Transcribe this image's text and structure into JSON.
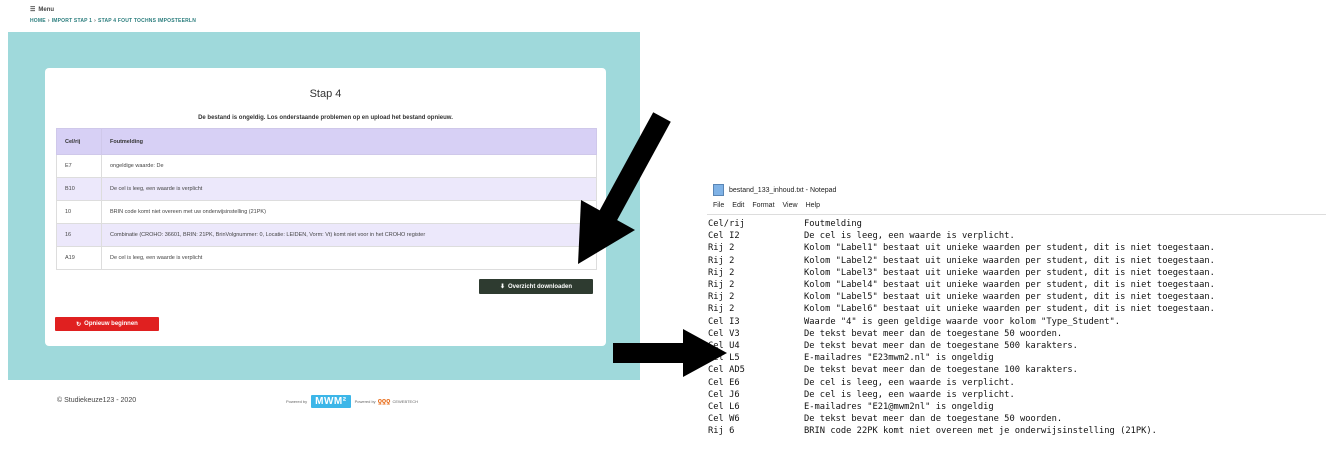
{
  "topnav": {
    "menu_label": "Menu",
    "crumbs": [
      "HOME",
      "IMPORT STAP 1",
      "STAP 4 FOUT TOCHNS IMPOSTEERLN"
    ]
  },
  "card": {
    "title": "Stap 4",
    "message": "De bestand is ongeldig. Los onderstaande problemen op en upload het bestand opnieuw.",
    "table": {
      "headers": [
        "Cel/rij",
        "Foutmelding"
      ],
      "rows": [
        [
          "E7",
          "ongeldige waarde: De"
        ],
        [
          "B10",
          "De cel is leeg, een waarde is verplicht"
        ],
        [
          "10",
          "BRIN code komt niet overeen met uw onderwijsinstelling (21PK)"
        ],
        [
          "16",
          "Combinatie (CROHO: 36601, BRIN: 21PK, BrinVolgnummer: 0, Locatie: LEIDEN, Vorm: Vt) komt niet voor in het CROHO register"
        ],
        [
          "A19",
          "De cel is leeg, een waarde is verplicht"
        ]
      ]
    },
    "download_label": "Overzicht downloaden",
    "restart_label": "Opnieuw beginnen"
  },
  "footer": {
    "copyright": "© Studiekeuze123 - 2020",
    "powered_by": "Powered by",
    "mwm": "MWM²",
    "powered_by2": "Powered by",
    "ceweb": "CEWEBTECH"
  },
  "notepad": {
    "title": "bestand_133_inhoud.txt - Notepad",
    "menu": [
      "File",
      "Edit",
      "Format",
      "View",
      "Help"
    ],
    "lines": [
      [
        "Cel/rij",
        "Foutmelding"
      ],
      [
        "Cel I2",
        "De cel is leeg, een waarde is verplicht."
      ],
      [
        "Rij 2",
        "Kolom \"Label1\" bestaat uit unieke waarden per student, dit is niet toegestaan."
      ],
      [
        "Rij 2",
        "Kolom \"Label2\" bestaat uit unieke waarden per student, dit is niet toegestaan."
      ],
      [
        "Rij 2",
        "Kolom \"Label3\" bestaat uit unieke waarden per student, dit is niet toegestaan."
      ],
      [
        "Rij 2",
        "Kolom \"Label4\" bestaat uit unieke waarden per student, dit is niet toegestaan."
      ],
      [
        "Rij 2",
        "Kolom \"Label5\" bestaat uit unieke waarden per student, dit is niet toegestaan."
      ],
      [
        "Rij 2",
        "Kolom \"Label6\" bestaat uit unieke waarden per student, dit is niet toegestaan."
      ],
      [
        "Cel I3",
        "Waarde \"4\" is geen geldige waarde voor kolom \"Type_Student\"."
      ],
      [
        "Cel V3",
        "De tekst bevat meer dan de toegestane 50 woorden."
      ],
      [
        "Cel U4",
        "De tekst bevat meer dan de toegestane 500 karakters."
      ],
      [
        "Cel L5",
        "E-mailadres \"E23mwm2.nl\" is ongeldig"
      ],
      [
        "Cel AD5",
        "De tekst bevat meer dan de toegestane 100 karakters."
      ],
      [
        "Cel E6",
        "De cel is leeg, een waarde is verplicht."
      ],
      [
        "Cel J6",
        "De cel is leeg, een waarde is verplicht."
      ],
      [
        "Cel L6",
        "E-mailadres \"E21@mwm2nl\" is ongeldig"
      ],
      [
        "Cel W6",
        "De tekst bevat meer dan de toegestane 50 woorden."
      ],
      [
        "Rij 6",
        "BRIN code 22PK komt niet overeen met je onderwijsinstelling (21PK)."
      ]
    ]
  },
  "colors": {
    "teal": "#9fd9db",
    "header_purple": "#d7d0f5",
    "download_btn": "#2e3b30",
    "restart_btn": "#e02020",
    "mwm_blue": "#3cb6e8"
  }
}
